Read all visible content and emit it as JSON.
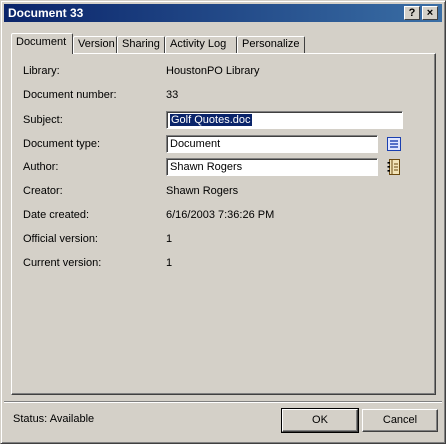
{
  "window": {
    "title": "Document 33",
    "help_glyph": "?",
    "close_glyph": "×"
  },
  "tabs": [
    {
      "label": "Document",
      "active": true
    },
    {
      "label": "Version",
      "active": false
    },
    {
      "label": "Sharing",
      "active": false
    },
    {
      "label": "Activity Log",
      "active": false
    },
    {
      "label": "Personalize",
      "active": false
    }
  ],
  "fields": {
    "library": {
      "label": "Library:",
      "value": "HoustonPO Library"
    },
    "document_number": {
      "label": "Document number:",
      "value": "33"
    },
    "subject": {
      "label": "Subject:",
      "value": "Golf Quotes.doc"
    },
    "document_type": {
      "label": "Document type:",
      "value": "Document",
      "icon": "list-icon"
    },
    "author": {
      "label": "Author:",
      "value": "Shawn Rogers",
      "icon": "address-book-icon"
    },
    "creator": {
      "label": "Creator:",
      "value": "Shawn Rogers"
    },
    "date_created": {
      "label": "Date created:",
      "value": "6/16/2003 7:36:26 PM"
    },
    "official_version": {
      "label": "Official version:",
      "value": "1"
    },
    "current_version": {
      "label": "Current version:",
      "value": "1"
    }
  },
  "status": {
    "text": "Status: Available"
  },
  "buttons": {
    "ok": "OK",
    "cancel": "Cancel"
  },
  "colors": {
    "titlebar": "#0a246a",
    "face": "#d4d0c8",
    "selection": "#0a246a"
  }
}
